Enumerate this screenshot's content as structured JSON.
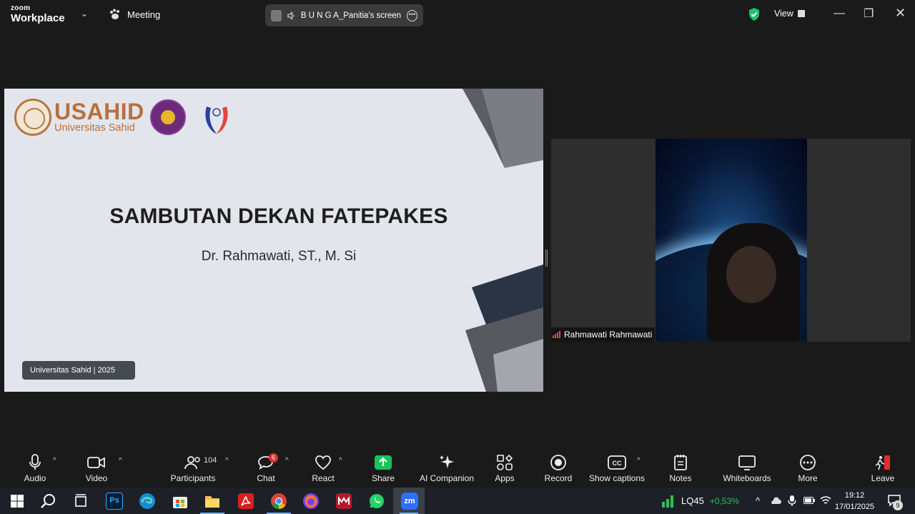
{
  "titlebar": {
    "brand_top": "zoom",
    "brand_bottom": "Workplace",
    "meeting_label": "Meeting",
    "screen_share_label": "B U N G A_Panitia's screen",
    "view_label": "View"
  },
  "slide": {
    "logo_name": "USAHID",
    "logo_subtitle": "Universitas Sahid",
    "title": "SAMBUTAN DEKAN FATEPAKES",
    "subtitle": "Dr. Rahmawati, ST.,  M. Si",
    "footer_badge": "Universitas Sahid |  2025"
  },
  "video": {
    "participant_name": "Rahmawati Rahmawati"
  },
  "toolbar": {
    "audio": "Audio",
    "video": "Video",
    "participants": "Participants",
    "participants_count": "104",
    "chat": "Chat",
    "chat_badge": "6",
    "react": "React",
    "share": "Share",
    "ai_companion": "AI Companion",
    "apps": "Apps",
    "record": "Record",
    "show_captions": "Show captions",
    "notes": "Notes",
    "whiteboards": "Whiteboards",
    "more": "More",
    "leave": "Leave"
  },
  "taskbar": {
    "stock_ticker": "LQ45",
    "stock_change": "+0,53%",
    "time": "19:12",
    "date": "17/01/2025",
    "notif_count": "9"
  },
  "colors": {
    "accent_green": "#1fc16b",
    "share_green": "#19c35b",
    "leave_red": "#e02e2e",
    "usahid_brown": "#b9703b"
  }
}
